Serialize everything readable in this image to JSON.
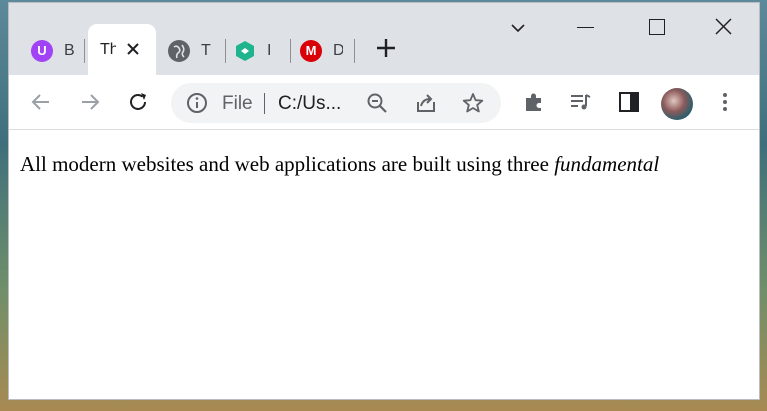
{
  "tabs": [
    {
      "title": "B",
      "favicon": "u-logo-icon",
      "color": "#a142f4",
      "active": false
    },
    {
      "title": "Th",
      "favicon": "none",
      "active": true
    },
    {
      "title": "T",
      "favicon": "globe-icon",
      "color": "#5f6368",
      "active": false
    },
    {
      "title": "I",
      "favicon": "green-hex-icon",
      "color": "#1db48e",
      "active": false
    },
    {
      "title": "D",
      "favicon": "mega-icon",
      "color": "#d90007",
      "active": false
    }
  ],
  "toolbar": {
    "scheme_label": "File",
    "url": "C:/Us..."
  },
  "page": {
    "text_plain": "All modern websites and web applications are built using three ",
    "text_italic": "fundamental"
  }
}
